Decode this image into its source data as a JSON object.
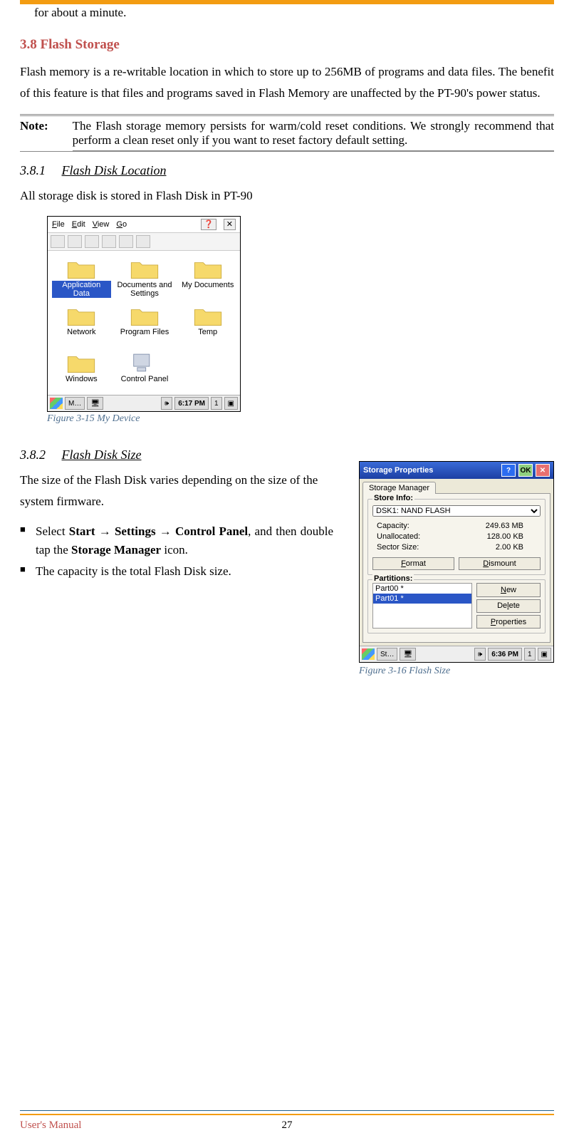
{
  "fragment_top": "for about a minute.",
  "section38": {
    "heading": "3.8  Flash Storage",
    "para": "Flash memory is a re-writable location in which to store up to 256MB of programs and data files. The benefit of this feature is that files and programs saved in Flash Memory are unaffected by the PT-90's power status."
  },
  "note": {
    "label": "Note:",
    "text": "The Flash storage memory persists for warm/cold reset conditions. We strongly recommend that perform a clean reset only if you want to reset factory default setting."
  },
  "sub381": {
    "num": "3.8.1",
    "title": "Flash Disk Location",
    "para": "All storage disk is stored in Flash Disk in PT-90",
    "caption": "Figure 3-15 My Device",
    "win": {
      "menus": {
        "file": "File",
        "edit": "Edit",
        "view": "View",
        "go": "Go"
      },
      "folders": [
        "Application Data",
        "Documents and Settings",
        "My Documents",
        "Network",
        "Program Files",
        "Temp",
        "Windows",
        "Control Panel"
      ],
      "taskbar": {
        "task": "M…",
        "time": "6:17 PM"
      }
    }
  },
  "sub382": {
    "num": "3.8.2",
    "title": "Flash Disk Size",
    "para": "The size of the Flash Disk varies depending on the size of the system firmware.",
    "bullets": {
      "b1": {
        "pre": "Select ",
        "start": "Start",
        "arrow1": " → ",
        "settings": "Settings",
        "arrow2": " → ",
        "cp": "Control Panel",
        "mid1": ", and then double tap the ",
        "sm": "Storage Manager",
        "mid2": " icon."
      },
      "b2": "The capacity is the total Flash Disk size."
    },
    "caption": "Figure 3-16 Flash Size",
    "win": {
      "title": "Storage Properties",
      "ok": "OK",
      "tab": "Storage Manager",
      "store_info": "Store Info:",
      "combo": "DSK1: NAND FLASH",
      "rows": {
        "capLabel": "Capacity:",
        "capVal": "249.63 MB",
        "unLabel": "Unallocated:",
        "unVal": "128.00 KB",
        "ssLabel": "Sector Size:",
        "ssVal": "2.00 KB"
      },
      "format": "Format",
      "dismount": "Dismount",
      "partitions": "Partitions:",
      "plist": [
        "Part00 *",
        "Part01 *"
      ],
      "new": "New",
      "delete": "Delete",
      "props": "Properties",
      "taskbar": {
        "task": "St…",
        "time": "6:36 PM"
      }
    }
  },
  "footer": {
    "left": "User's Manual",
    "page": "27"
  }
}
